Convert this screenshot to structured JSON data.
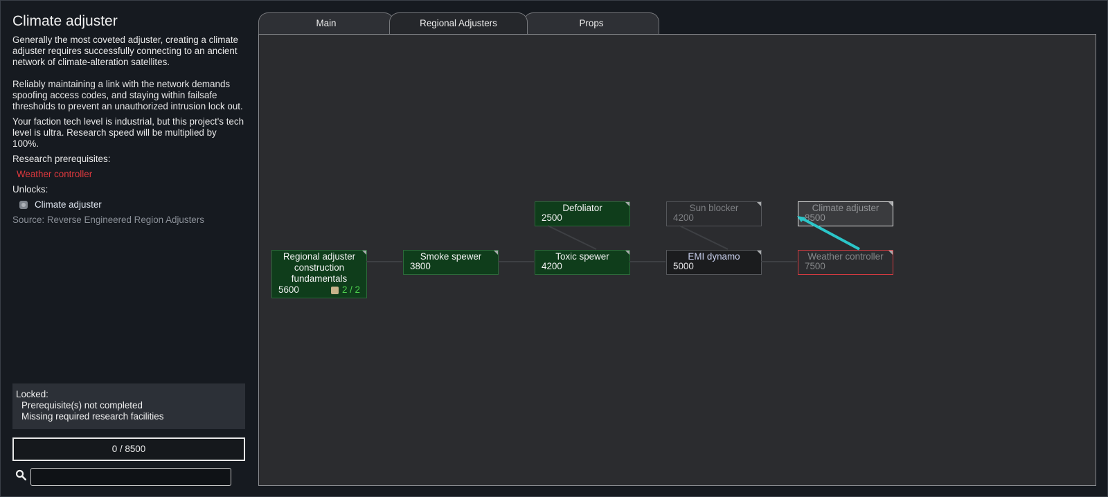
{
  "left_panel": {
    "title": "Climate adjuster",
    "desc1": "Generally the most coveted adjuster, creating a climate adjuster requires successfully connecting to an ancient network of climate-alteration satellites.",
    "desc2": "Reliably maintaining a link with the network demands spoofing access codes, and staying within failsafe thresholds to prevent an unauthorized intrusion lock out.",
    "tech_text": "Your faction tech level is industrial, but this project's tech level is ultra. Research speed will be multiplied by 100%.",
    "prereq_label": "Research prerequisites:",
    "prereq_item": "Weather controller",
    "unlocks_label": "Unlocks:",
    "unlock_item": "Climate adjuster",
    "source": "Source:  Reverse Engineered Region Adjusters",
    "locked_title": "Locked:",
    "locked_reason1": "Prerequisite(s) not completed",
    "locked_reason2": "Missing required research facilities",
    "progress": "0 / 8500",
    "search_value": ""
  },
  "tabs": [
    {
      "label": "Main"
    },
    {
      "label": "Regional Adjusters"
    },
    {
      "label": "Props"
    }
  ],
  "active_tab": "Regional Adjusters",
  "nodes": {
    "regional": {
      "name": "Regional adjuster construction fundamentals",
      "cost": "5600",
      "count": "2 / 2"
    },
    "smoke": {
      "name": "Smoke spewer",
      "cost": "3800"
    },
    "defoliator": {
      "name": "Defoliator",
      "cost": "2500"
    },
    "toxic": {
      "name": "Toxic spewer",
      "cost": "4200"
    },
    "sunblocker": {
      "name": "Sun blocker",
      "cost": "4200"
    },
    "emi": {
      "name": "EMI dynamo",
      "cost": "5000"
    },
    "climate": {
      "name": "Climate adjuster",
      "cost": "8500"
    },
    "weather": {
      "name": "Weather controller",
      "cost": "7500"
    }
  },
  "colors": {
    "completed": "#0f3d1b",
    "prerequisite_missing": "#d33a40",
    "link_highlight": "#2bc6c9",
    "count_text": "#4ed14e"
  }
}
